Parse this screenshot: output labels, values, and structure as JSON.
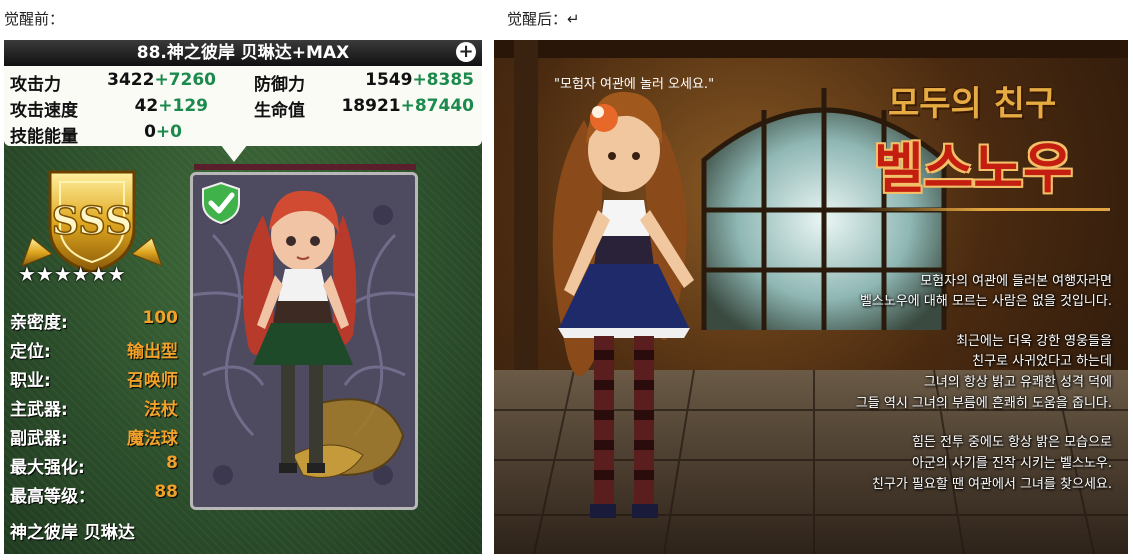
{
  "captions": {
    "before": "觉醒前：",
    "after": "觉醒后：↵"
  },
  "card": {
    "title": "88.神之彼岸 贝琳达+MAX",
    "stats": [
      {
        "label": "攻击力",
        "base": "3422",
        "bonus": "+7260"
      },
      {
        "label": "防御力",
        "base": "1549",
        "bonus": "+8385"
      },
      {
        "label": "攻击速度",
        "base": "42",
        "bonus": "+129"
      },
      {
        "label": "生命值",
        "base": "18921",
        "bonus": "+87440"
      },
      {
        "label": "技能能量",
        "base": "0",
        "bonus": "+0"
      }
    ],
    "rank": "SSS",
    "stars": "★★★★★★",
    "info": [
      {
        "label": "亲密度:",
        "value": "100"
      },
      {
        "label": "定位:",
        "value": "输出型"
      },
      {
        "label": "职业:",
        "value": "召唤师"
      },
      {
        "label": "主武器:",
        "value": "法杖"
      },
      {
        "label": "副武器:",
        "value": "魔法球"
      },
      {
        "label": "最大强化:",
        "value": "8"
      },
      {
        "label": "最高等级：",
        "value": "88"
      }
    ],
    "name": "神之彼岸 贝琳达"
  },
  "awakened": {
    "quote": "\"모험자 여관에 놀러 오세요.\"",
    "title_small": "모두의 친구",
    "title_big": "벨스노우",
    "lines": [
      "모험자의 여관에 들러본 여행자라면",
      "벨스노우에 대해 모르는 사람은 없을 것입니다.",
      "최근에는 더욱 강한 영웅들을",
      "친구로 사귀었다고 하는데",
      "그녀의 항상 밝고 유쾌한 성격 덕에",
      "그들 역시 그녀의 부름에 흔쾌히 도움을 줍니다.",
      "힘든 전투 중에도 항상 밝은 모습으로",
      "아군의 사기를 진작 시키는 벨스노우.",
      "친구가 필요할 땐 여관에서 그녀를 찾으세요."
    ]
  },
  "colors": {
    "bonus": "#1b8a4c",
    "info_value": "#f2a12a",
    "title_big": "#c41e10",
    "title_small": "#e6ab43"
  }
}
